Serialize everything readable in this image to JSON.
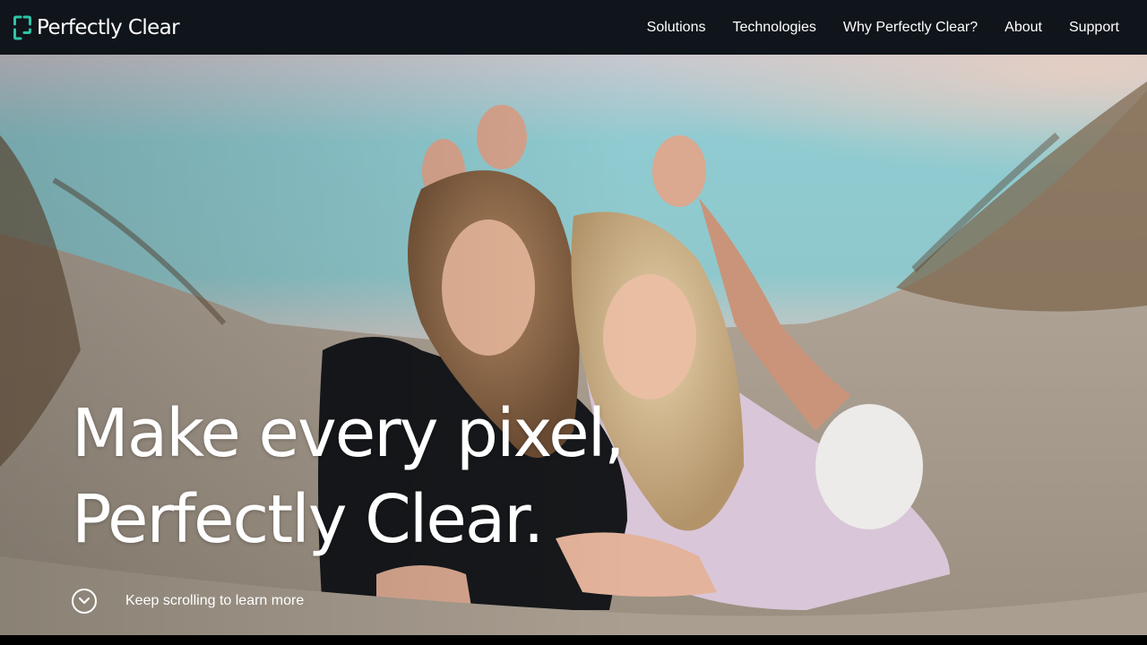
{
  "brand": {
    "name": "Perfectly Clear",
    "logo_icon": "bracket-logo-icon",
    "accent": "#2ec4a6"
  },
  "nav": {
    "items": [
      {
        "label": "Solutions"
      },
      {
        "label": "Technologies"
      },
      {
        "label": "Why Perfectly Clear?"
      },
      {
        "label": "About"
      },
      {
        "label": "Support"
      }
    ],
    "background": "#10151b"
  },
  "hero": {
    "headline_line1": "Make every pixel,",
    "headline_line2": "Perfectly Clear.",
    "scroll_label": "Keep scrolling to learn more",
    "scroll_icon": "chevron-down-icon",
    "image_subject": "photo-two-women-on-beach-sand-dunes"
  }
}
